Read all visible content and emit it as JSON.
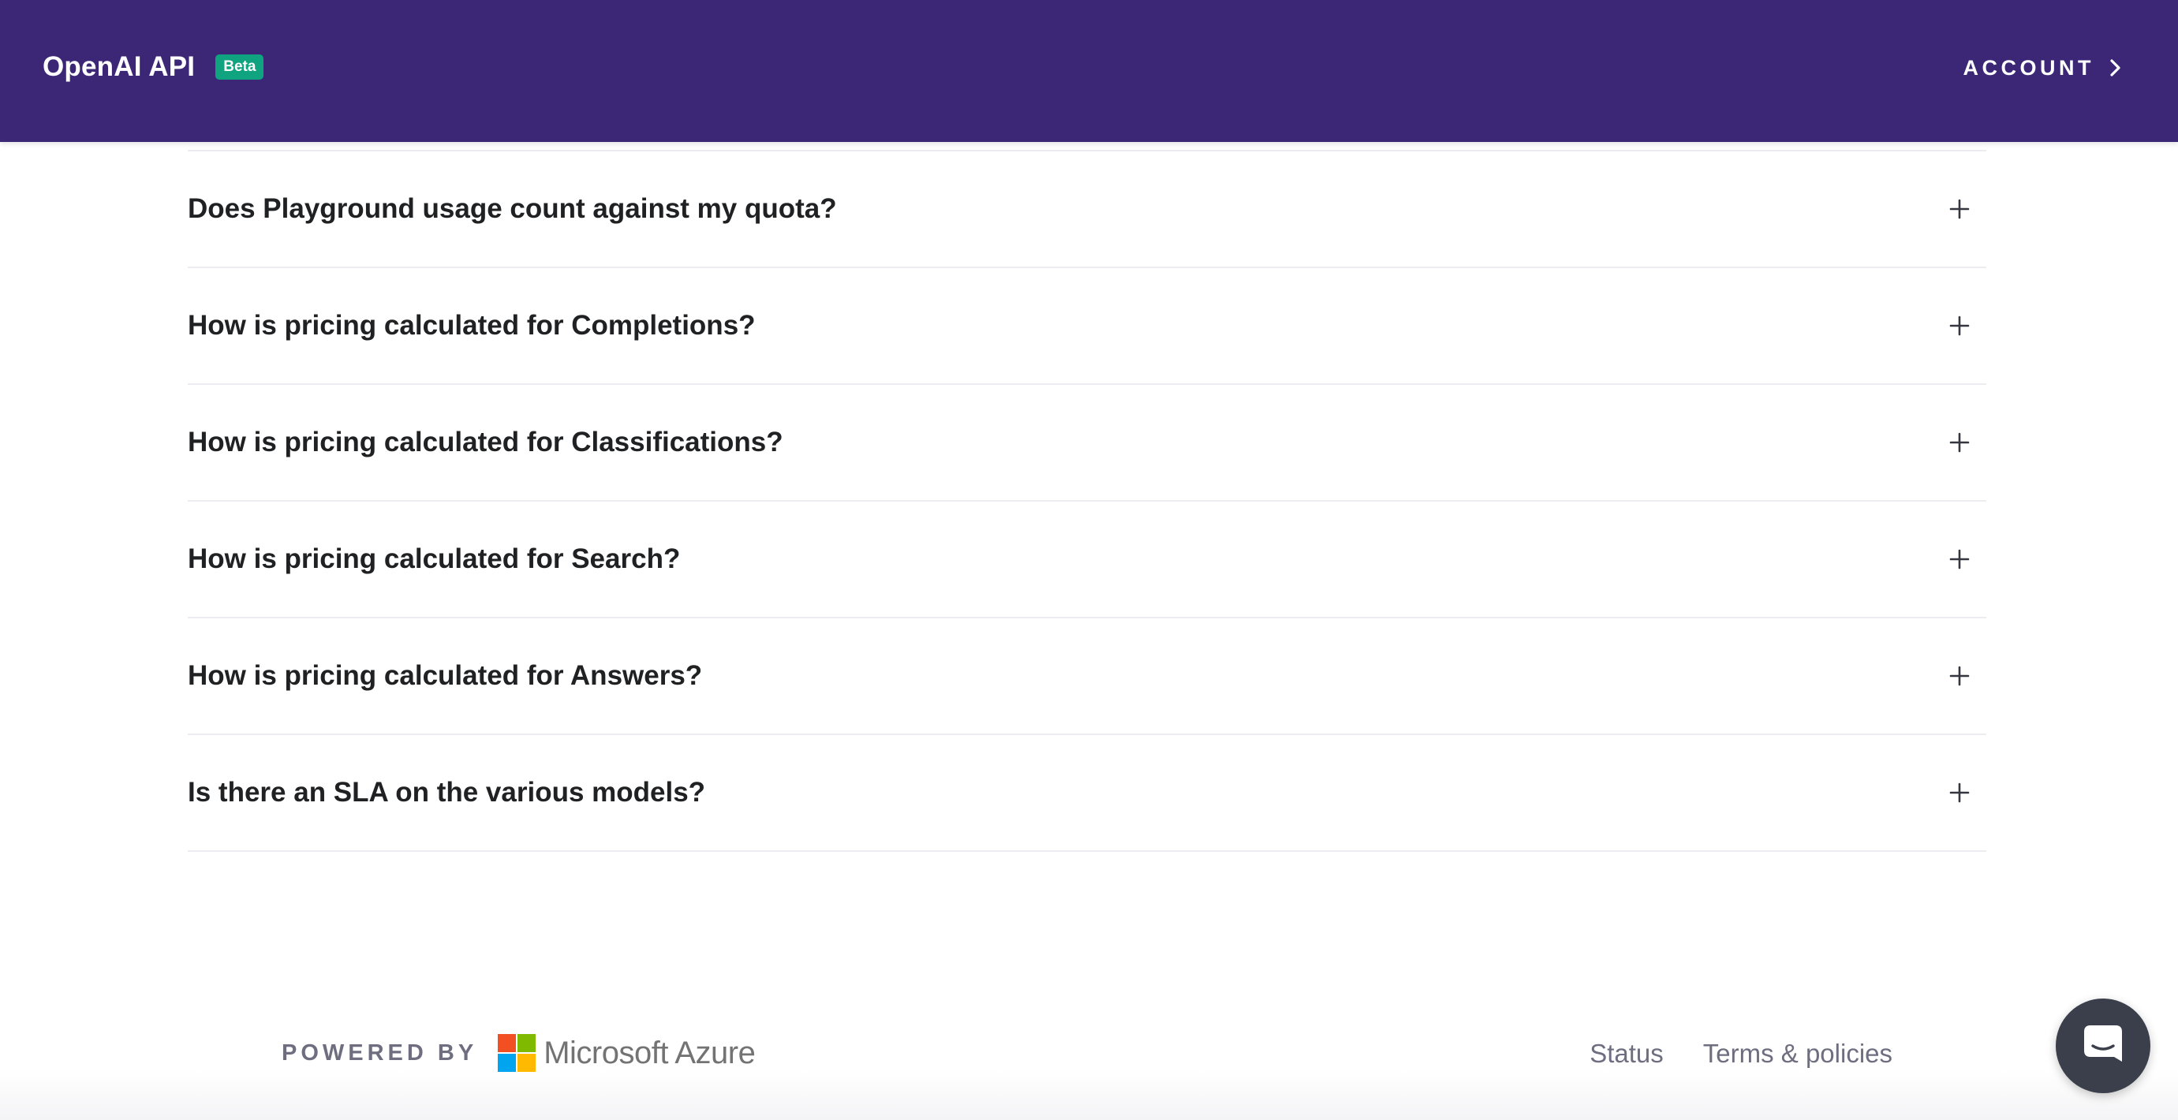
{
  "header": {
    "title": "OpenAI API",
    "badge": "Beta",
    "account_label": "ACCOUNT",
    "background_color": "#3c2776",
    "badge_color": "#10a37f"
  },
  "faq": {
    "questions": [
      "Does Playground usage count against my quota?",
      "How is pricing calculated for Completions?",
      "How is pricing calculated for Classifications?",
      "How is pricing calculated for Search?",
      "How is pricing calculated for Answers?",
      "Is there an SLA on the various models?"
    ],
    "expand_icon": "plus-icon"
  },
  "footer": {
    "powered_by_label": "POWERED BY",
    "provider_name": "Microsoft Azure",
    "provider_logo_colors": [
      "#f25022",
      "#7fba00",
      "#00a4ef",
      "#ffb900"
    ],
    "links": [
      "Status",
      "Terms & policies"
    ]
  },
  "chat_launcher": {
    "icon": "chat-bubble-icon",
    "color": "#3b3f4b"
  }
}
